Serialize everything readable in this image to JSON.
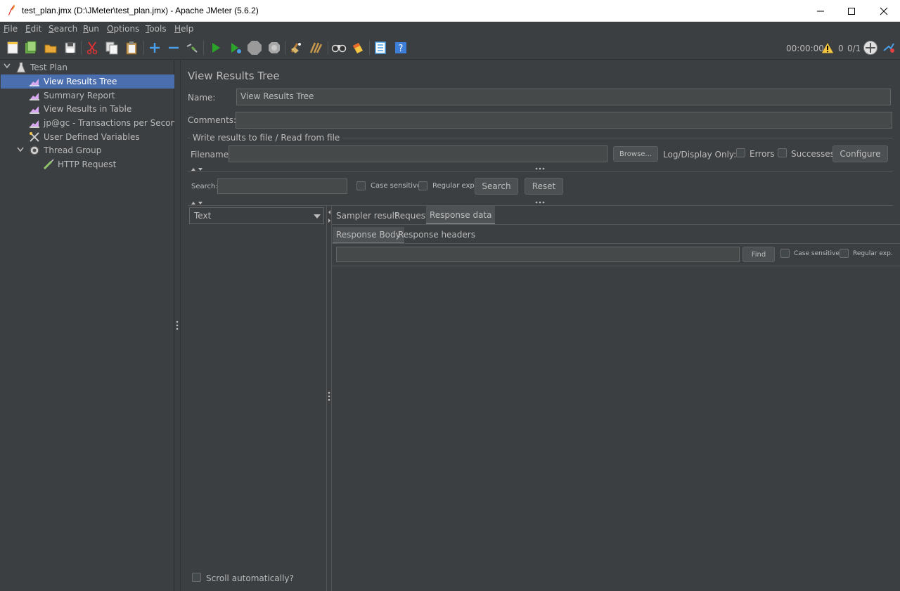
{
  "window": {
    "title": "test_plan.jmx (D:\\JMeter\\test_plan.jmx) - Apache JMeter (5.6.2)",
    "minimize_icon": "minimize-icon",
    "maximize_icon": "maximize-icon",
    "close_icon": "close-icon"
  },
  "menu": [
    {
      "label": "File",
      "mn": "F",
      "rest": "ile"
    },
    {
      "label": "Edit",
      "mn": "E",
      "rest": "dit"
    },
    {
      "label": "Search",
      "mn": "S",
      "rest": "earch"
    },
    {
      "label": "Run",
      "mn": "R",
      "rest": "un"
    },
    {
      "label": "Options",
      "mn": "O",
      "rest": "ptions"
    },
    {
      "label": "Tools",
      "mn": "T",
      "rest": "ools"
    },
    {
      "label": "Help",
      "mn": "H",
      "rest": "elp"
    }
  ],
  "toolbar": {
    "timer": "00:00:00",
    "warnings": "0",
    "threads": "0/1",
    "icons": [
      "new-icon",
      "templates-icon",
      "open-icon",
      "save-icon",
      "cut-icon",
      "copy-icon",
      "paste-icon",
      "expand-icon",
      "collapse-icon",
      "toggle-icon",
      "start-icon",
      "start-no-pause-icon",
      "stop-icon",
      "shutdown-icon",
      "clear-icon",
      "clear-all-icon",
      "search-icon",
      "reset-search-icon",
      "function-helper-icon",
      "help-icon"
    ]
  },
  "tree": {
    "root": "Test Plan",
    "items": [
      {
        "label": "View Results Tree",
        "icon": "graph-icon"
      },
      {
        "label": "Summary Report",
        "icon": "graph-icon"
      },
      {
        "label": "View Results in Table",
        "icon": "graph-icon"
      },
      {
        "label": "jp@gc - Transactions per Second",
        "icon": "graph-icon"
      },
      {
        "label": "User Defined Variables",
        "icon": "variables-icon"
      },
      {
        "label": "Thread Group",
        "icon": "thread-group-icon"
      },
      {
        "label": "HTTP Request",
        "icon": "sampler-icon"
      }
    ]
  },
  "panel": {
    "title": "View Results Tree",
    "name_label": "Name:",
    "name_value": "View Results Tree",
    "comments_label": "Comments:",
    "comments_value": "",
    "file_group_label": "Write results to file / Read from file",
    "filename_label": "Filename",
    "filename_value": "",
    "browse_label": "Browse...",
    "log_display_label": "Log/Display Only:",
    "errors_label": "Errors",
    "successes_label": "Successes",
    "configure_label": "Configure",
    "search_label": "Search:",
    "search_value": "",
    "case_sensitive_label": "Case sensitive",
    "regex_label": "Regular exp.",
    "search_button": "Search",
    "reset_button": "Reset",
    "renderer_selected": "Text",
    "tabs": [
      "Sampler result",
      "Request",
      "Response data"
    ],
    "subtabs": [
      "Response Body",
      "Response headers"
    ],
    "find_button": "Find",
    "find_case_label": "Case sensitive",
    "find_regex_label": "Regular exp.",
    "scroll_auto_label": "Scroll automatically?"
  }
}
